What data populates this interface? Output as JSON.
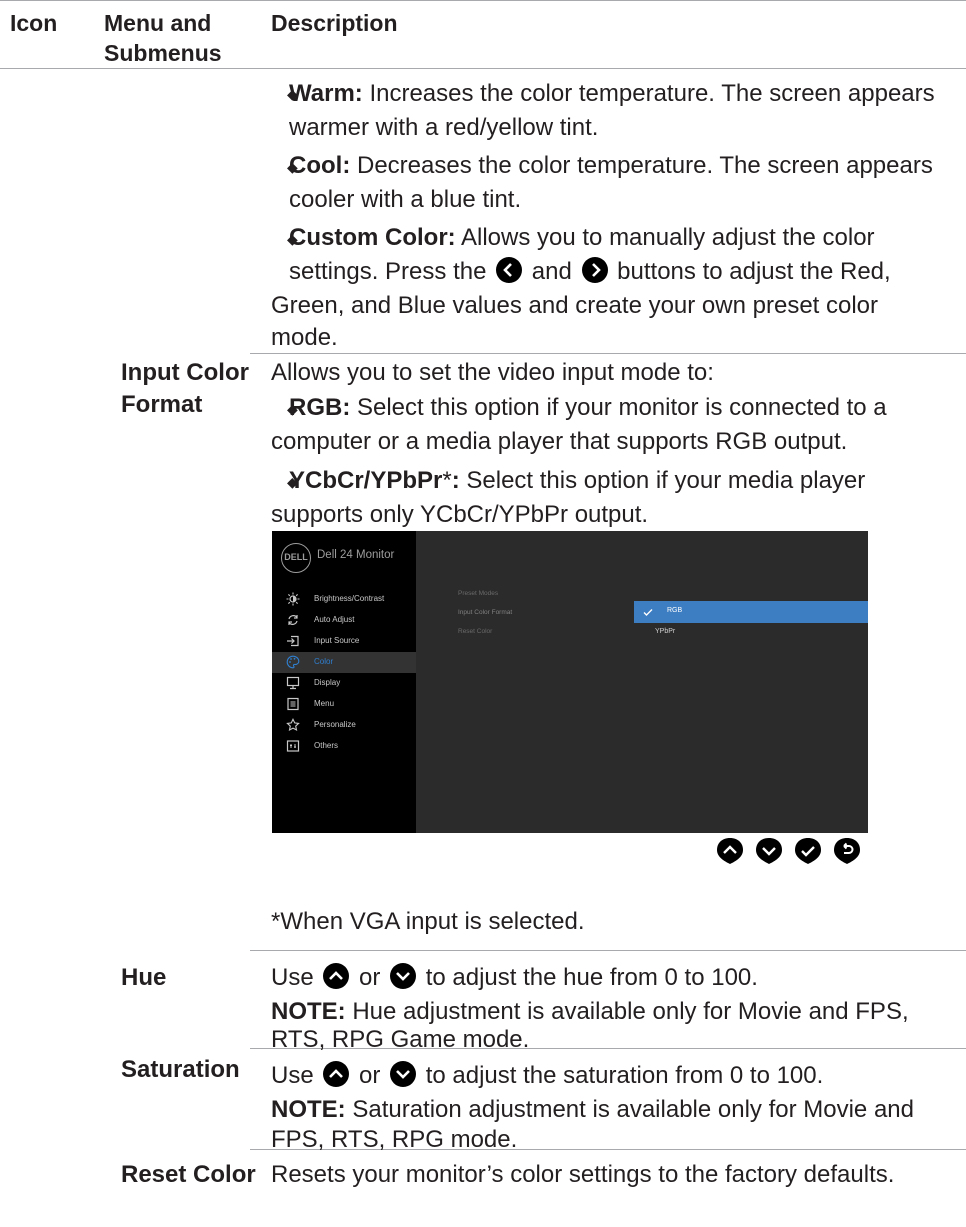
{
  "header": {
    "col_icon": "Icon",
    "col_menu": "Menu and Submenus",
    "col_desc": "Description"
  },
  "color_modes": [
    {
      "name": "Warm:",
      "text_l1": " Increases the color temperature. The screen appears",
      "text_l2": "warmer with a red/yellow tint."
    },
    {
      "name": "Cool:",
      "text_l1": " Decreases the color temperature. The screen appears",
      "text_l2": "cooler with a blue tint."
    },
    {
      "name": "Custom Color:",
      "text_l1": " Allows you to manually adjust the color",
      "text_l2a": "settings. Press the",
      "text_l2b": "and",
      "text_l2c": "buttons to adjust the Red,",
      "text_l3": "Green, and Blue values and create your own preset color",
      "text_l4": "mode."
    }
  ],
  "input_color_format": {
    "label_l1": "Input Color",
    "label_l2": "Format",
    "intro": "Allows you to set the video input mode to:",
    "rgb_name": "RGB:",
    "rgb_l1": " Select this option if your monitor is connected to a",
    "rgb_l2": "computer or a media player that supports RGB output.",
    "ycb_name": "YCbCr/YPbPr",
    "ycb_star": "*",
    "ycb_colon": ":",
    "ycb_l1": " Select this option if your media player",
    "ycb_l2": "supports only YCbCr/YPbPr output.",
    "footnote": "*When VGA input is selected."
  },
  "osd": {
    "logo": "DELL",
    "title": "Dell 24 Monitor",
    "menu": [
      {
        "label": "Brightness/Contrast",
        "icon": "brightness-icon"
      },
      {
        "label": "Auto Adjust",
        "icon": "auto-adjust-icon"
      },
      {
        "label": "Input Source",
        "icon": "input-source-icon"
      },
      {
        "label": "Color",
        "icon": "color-palette-icon",
        "selected": true
      },
      {
        "label": "Display",
        "icon": "display-icon"
      },
      {
        "label": "Menu",
        "icon": "menu-icon"
      },
      {
        "label": "Personalize",
        "icon": "star-icon"
      },
      {
        "label": "Others",
        "icon": "others-icon"
      }
    ],
    "submenu": [
      "Preset Modes",
      "Input Color Format",
      "Reset Color"
    ],
    "options": [
      "RGB",
      "YPbPr"
    ],
    "selected_option": "RGB"
  },
  "hue": {
    "label": "Hue",
    "use": "Use",
    "or": "or",
    "text": "to adjust the hue from 0 to 100.",
    "note_label": "NOTE:",
    "note_l1": " Hue adjustment is available only for Movie and FPS,",
    "note_l2": "RTS, RPG Game mode."
  },
  "saturation": {
    "label": "Saturation",
    "use": "Use",
    "or": "or",
    "text": "to adjust the saturation from 0 to 100.",
    "note_label": "NOTE:",
    "note_l1": " Saturation adjustment is available only for Movie and",
    "note_l2": "FPS, RTS, RPG mode."
  },
  "reset_color": {
    "label": "Reset Color",
    "text": "Resets your monitor’s color settings to the factory defaults."
  }
}
